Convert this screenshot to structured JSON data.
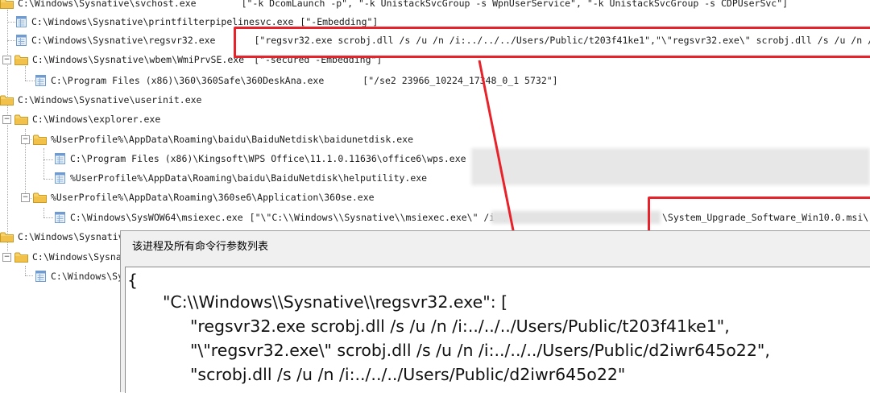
{
  "tree": {
    "row0": {
      "path": "C:\\Windows\\Sysnative\\svchost.exe",
      "args": "[\"-k DcomLaunch -p\", \"-k UnistackSvcGroup -s WpnUserService\", \"-k UnistackSvcGroup -s CDPUserSvc\"]"
    },
    "row1": {
      "path": "C:\\Windows\\Sysnative\\printfilterpipelinesvc.exe",
      "args": "[\"-Embedding\"]"
    },
    "row2": {
      "path": "C:\\Windows\\Sysnative\\regsvr32.exe",
      "args": "[\"regsvr32.exe scrobj.dll /s /u /n /i:../../../Users/Public/t203f41ke1\",\"\\\"regsvr32.exe\\\" scrobj.dll /s /u /n /i:../"
    },
    "row3": {
      "path": "C:\\Windows\\Sysnative\\wbem\\WmiPrvSE.exe",
      "args": "[\"-secured -Embedding\"]"
    },
    "row4": {
      "path": "C:\\Program Files (x86)\\360\\360Safe\\360DeskAna.exe",
      "args": "[\"/se2 23966_10224_17348_0_1 5732\"]"
    },
    "row5": {
      "path": "C:\\Windows\\Sysnative\\userinit.exe"
    },
    "row6": {
      "path": "C:\\Windows\\explorer.exe"
    },
    "row7": {
      "path": "%UserProfile%\\AppData\\Roaming\\baidu\\BaiduNetdisk\\baidunetdisk.exe"
    },
    "row8": {
      "path": "C:\\Program Files (x86)\\Kingsoft\\WPS Office\\11.1.0.11636\\office6\\wps.exe"
    },
    "row9": {
      "path": "%UserProfile%\\AppData\\Roaming\\baidu\\BaiduNetdisk\\helputility.exe"
    },
    "row10": {
      "path": "%UserProfile%\\AppData\\Roaming\\360se6\\Application\\360se.exe"
    },
    "row11": {
      "path": "C:\\Windows\\SysWOW64\\msiexec.exe",
      "args_a": "[\"\\\"C:\\\\Windows\\\\Sysnative\\\\msiexec.exe\\\" /i \\",
      "args_b": "\\System_Upgrade_Software_Win10.0.msi\\\""
    },
    "row12": {
      "path": "C:\\Windows\\Sysnative"
    },
    "row13": {
      "path": "C:\\Windows\\Sysnat"
    },
    "row14": {
      "path": "C:\\Windows\\Sy"
    }
  },
  "dialog": {
    "title": "该进程及所有命令行参数列表",
    "json_lines": [
      "{",
      "\"C:\\\\Windows\\\\Sysnative\\\\regsvr32.exe\": [",
      "\"regsvr32.exe scrobj.dll /s /u /n /i:../../../Users/Public/t203f41ke1\",",
      "\"\\\"regsvr32.exe\\\" scrobj.dll /s /u /n /i:../../../Users/Public/d2iwr645o22\",",
      "\"scrobj.dll /s /u /n /i:../../../Users/Public/d2iwr645o22\""
    ]
  },
  "icons": {
    "toggle": "minus-toggle-icon",
    "folder": "folder-icon",
    "file": "executable-file-icon"
  },
  "colors": {
    "highlight": "#e8222a",
    "folder": "#f2c94c",
    "file": "#5b9bd5"
  }
}
